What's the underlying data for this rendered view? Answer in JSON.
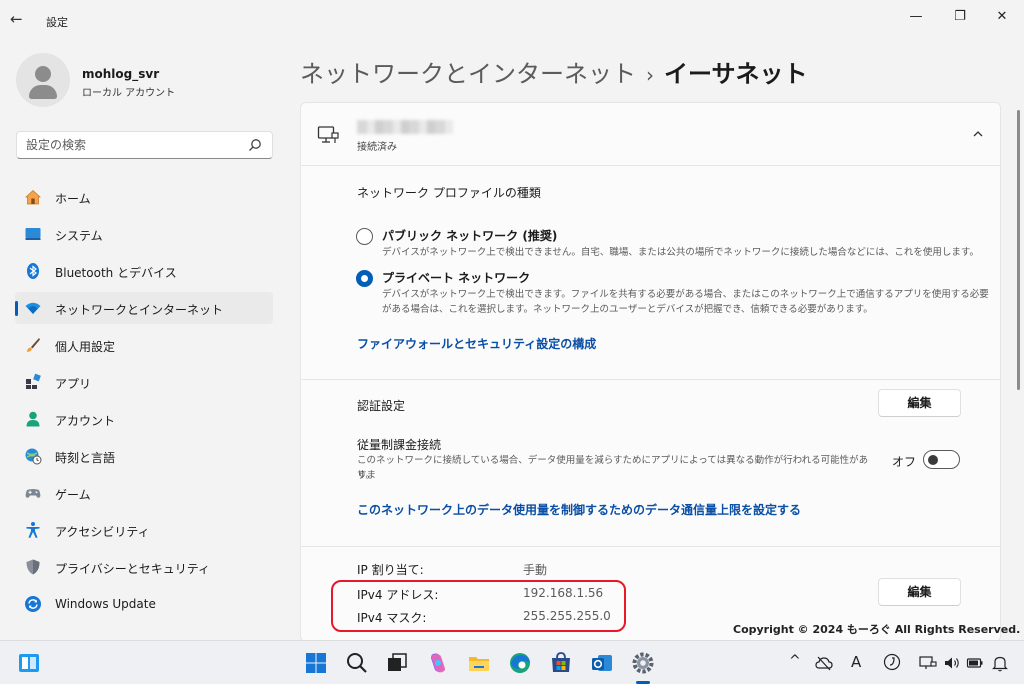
{
  "window": {
    "title": "設定",
    "back": "←",
    "minimize": "—",
    "restore": "❐",
    "close": "✕"
  },
  "account": {
    "name": "mohlog_svr",
    "type": "ローカル アカウント"
  },
  "search": {
    "placeholder": "設定の検索"
  },
  "sidebar": {
    "items": [
      {
        "label": "ホーム",
        "icon": "home-icon"
      },
      {
        "label": "システム",
        "icon": "system-icon"
      },
      {
        "label": "Bluetooth とデバイス",
        "icon": "bluetooth-icon"
      },
      {
        "label": "ネットワークとインターネット",
        "icon": "wifi-icon",
        "active": true
      },
      {
        "label": "個人用設定",
        "icon": "brush-icon"
      },
      {
        "label": "アプリ",
        "icon": "apps-icon"
      },
      {
        "label": "アカウント",
        "icon": "account-icon"
      },
      {
        "label": "時刻と言語",
        "icon": "globe-clock-icon"
      },
      {
        "label": "ゲーム",
        "icon": "gamepad-icon"
      },
      {
        "label": "アクセシビリティ",
        "icon": "accessibility-icon"
      },
      {
        "label": "プライバシーとセキュリティ",
        "icon": "shield-icon"
      },
      {
        "label": "Windows Update",
        "icon": "update-icon"
      }
    ]
  },
  "header": {
    "parent": "ネットワークとインターネット",
    "separator": "›",
    "current": "イーサネット"
  },
  "connection": {
    "status": "接続済み"
  },
  "profile": {
    "label": "ネットワーク プロファイルの種類",
    "public_title": "パブリック ネットワーク (推奨)",
    "public_desc": "デバイスがネットワーク上で検出できません。自宅、職場、または公共の場所でネットワークに接続した場合などには、これを使用します。",
    "private_title": "プライベート ネットワーク",
    "private_desc_1": "デバイスがネットワーク上で検出できます。ファイルを共有する必要がある場合、またはこのネットワーク上で通信するアプリを使用する必要",
    "private_desc_2": "がある場合は、これを選択します。ネットワーク上のユーザーとデバイスが把握でき、信頼できる必要があります。",
    "selected": "private",
    "firewall_link": "ファイアウォールとセキュリティ設定の構成"
  },
  "auth": {
    "label": "認証設定",
    "edit": "編集"
  },
  "metered": {
    "label": "従量制課金接続",
    "desc_1": "このネットワークに接続している場合、データ使用量を減らすためにアプリによっては異なる動作が行われる可能性がありま",
    "desc_2": "す。",
    "toggle_label": "オフ",
    "toggle_on": false,
    "limit_link": "このネットワーク上のデータ使用量を制御するためのデータ通信量上限を設定する"
  },
  "ip": {
    "assign_label": "IP 割り当て:",
    "assign_value": "手動",
    "ipv4_address_label": "IPv4 アドレス:",
    "ipv4_address_value": "192.168.1.56",
    "ipv4_mask_label": "IPv4 マスク:",
    "ipv4_mask_value": "255.255.255.0",
    "edit": "編集"
  },
  "copyright": "Copyright © 2024 もーろぐ All Rights Reserved.",
  "taskbar": {
    "icons": [
      "widgets-icon",
      "start-icon",
      "search-icon",
      "task-view-icon",
      "copilot-icon",
      "file-explorer-icon",
      "edge-icon",
      "store-icon",
      "outlook-icon",
      "settings-icon"
    ],
    "tray": {
      "chevron": "^",
      "ime": "A"
    }
  },
  "colors": {
    "accent": "#005fb8",
    "link": "#0a4fa5",
    "highlight": "#e8172a"
  }
}
